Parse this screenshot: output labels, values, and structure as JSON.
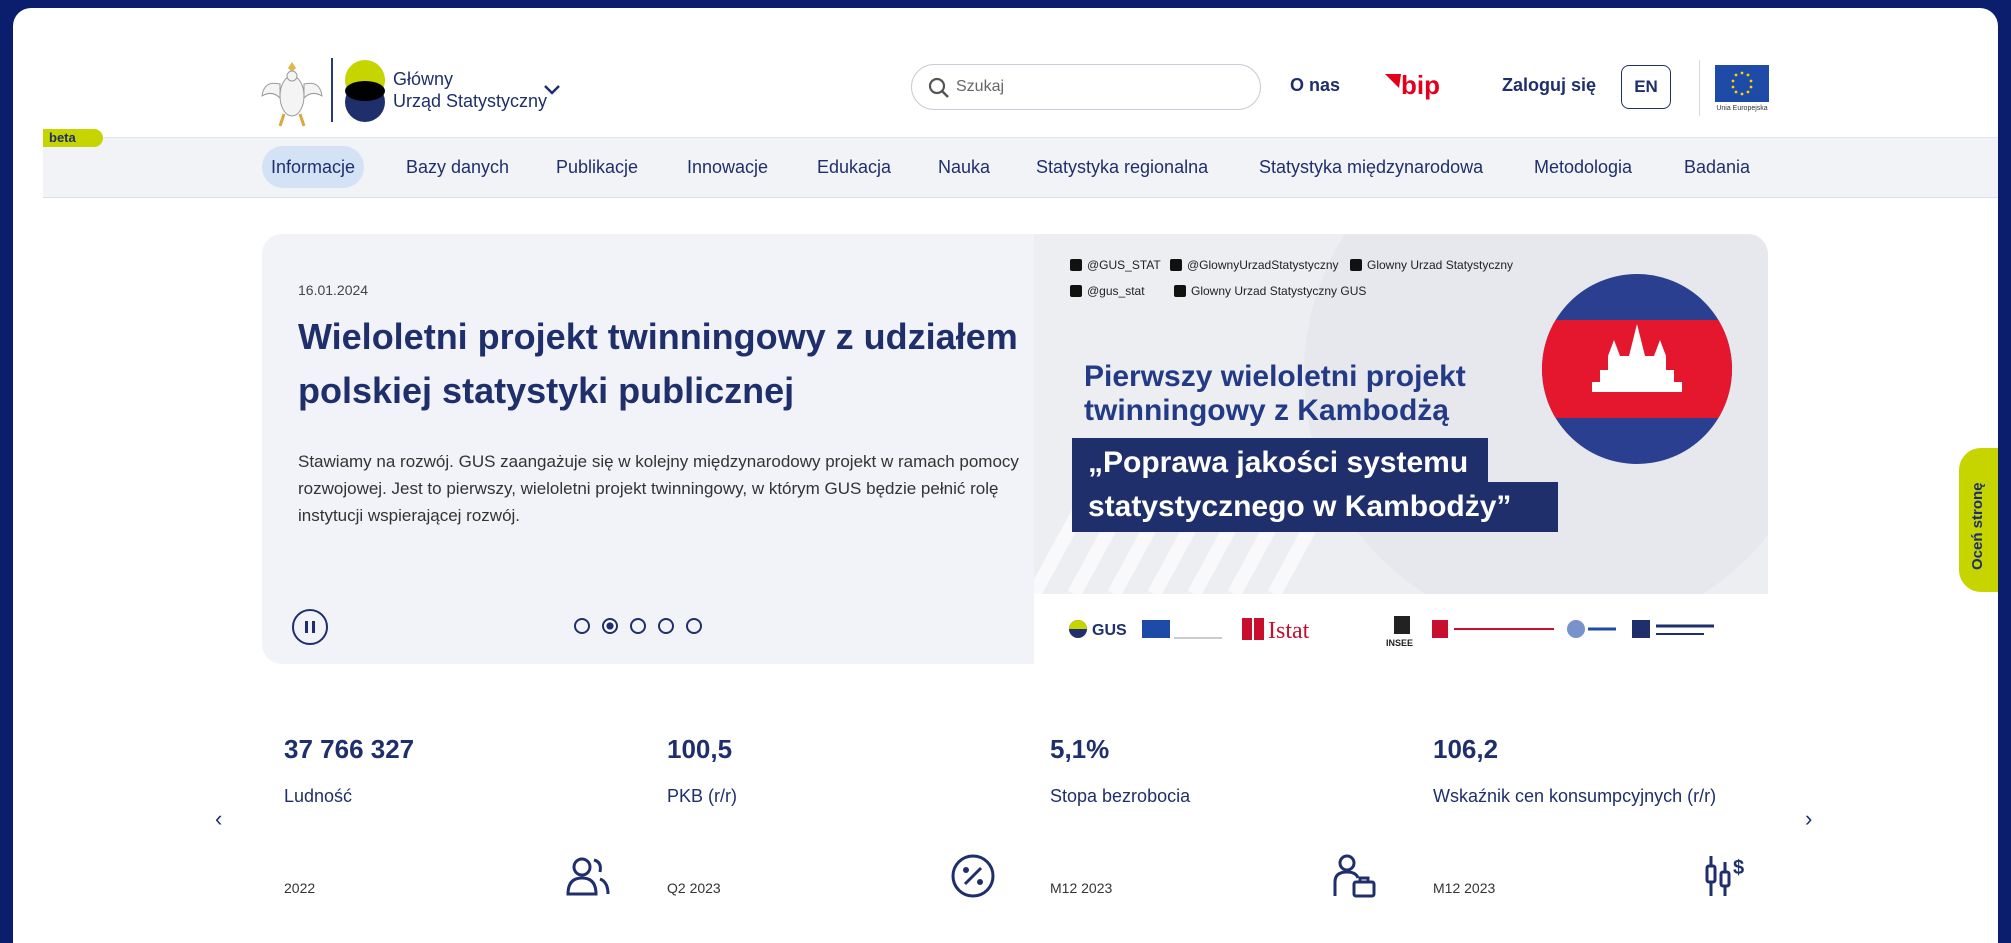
{
  "header": {
    "logo_line1": "Główny",
    "logo_line2": "Urząd Statystyczny",
    "search_placeholder": "Szukaj",
    "onas": "O nas",
    "bip": "bip",
    "login": "Zaloguj się",
    "lang": "EN",
    "eu_label": "Unia Europejska"
  },
  "beta": "beta",
  "nav": {
    "items": [
      "Informacje",
      "Bazy danych",
      "Publikacje",
      "Innowacje",
      "Edukacja",
      "Nauka",
      "Statystyka regionalna",
      "Statystyka międzynarodowa",
      "Metodologia",
      "Badania"
    ],
    "active_index": 0
  },
  "hero": {
    "date": "16.01.2024",
    "title": "Wieloletni projekt twinningowy z udziałem polskiej statystyki publicznej",
    "text": "Stawiamy na rozwój. GUS zaangażuje się w kolejny międzynarodowy projekt w ramach pomocy rozwojowej. Jest to pierwszy, wieloletni projekt twinningowy, w którym GUS będzie pełnić rolę instytucji wspierającej rozwój.",
    "slide_count": 5,
    "active_slide": 1,
    "image": {
      "social": [
        "@GUS_STAT",
        "@GlownyUrzadStatystyczny",
        "Glowny Urzad Statystyczny",
        "@gus_stat",
        "Glowny Urzad Statystyczny GUS"
      ],
      "title_line1": "Pierwszy wieloletni projekt",
      "title_line2": "twinningowy z Kambodżą",
      "box_line1": "„Poprawa jakości systemu",
      "box_line2": "statystycznego w Kambodży”",
      "partners": [
        "GUS",
        "Istat",
        "INSEE"
      ]
    }
  },
  "stats": [
    {
      "value": "37 766 327",
      "label": "Ludność",
      "period": "2022",
      "icon": "people-icon"
    },
    {
      "value": "100,5",
      "label": "PKB (r/r)",
      "period": "Q2 2023",
      "icon": "percent-icon"
    },
    {
      "value": "5,1%",
      "label": "Stopa bezrobocia",
      "period": "M12 2023",
      "icon": "unemployed-person-icon"
    },
    {
      "value": "106,2",
      "label": "Wskaźnik cen konsumpcyjnych (r/r)",
      "period": "M12 2023",
      "icon": "price-index-icon"
    }
  ],
  "rate_tab": "Oceń stronę",
  "colors": {
    "brand_navy": "#1f2f6b",
    "accent_lime": "#c6d400",
    "background_outer": "#0b1e6e",
    "nav_active": "#d4e2f6",
    "bip_red": "#e4001b"
  }
}
